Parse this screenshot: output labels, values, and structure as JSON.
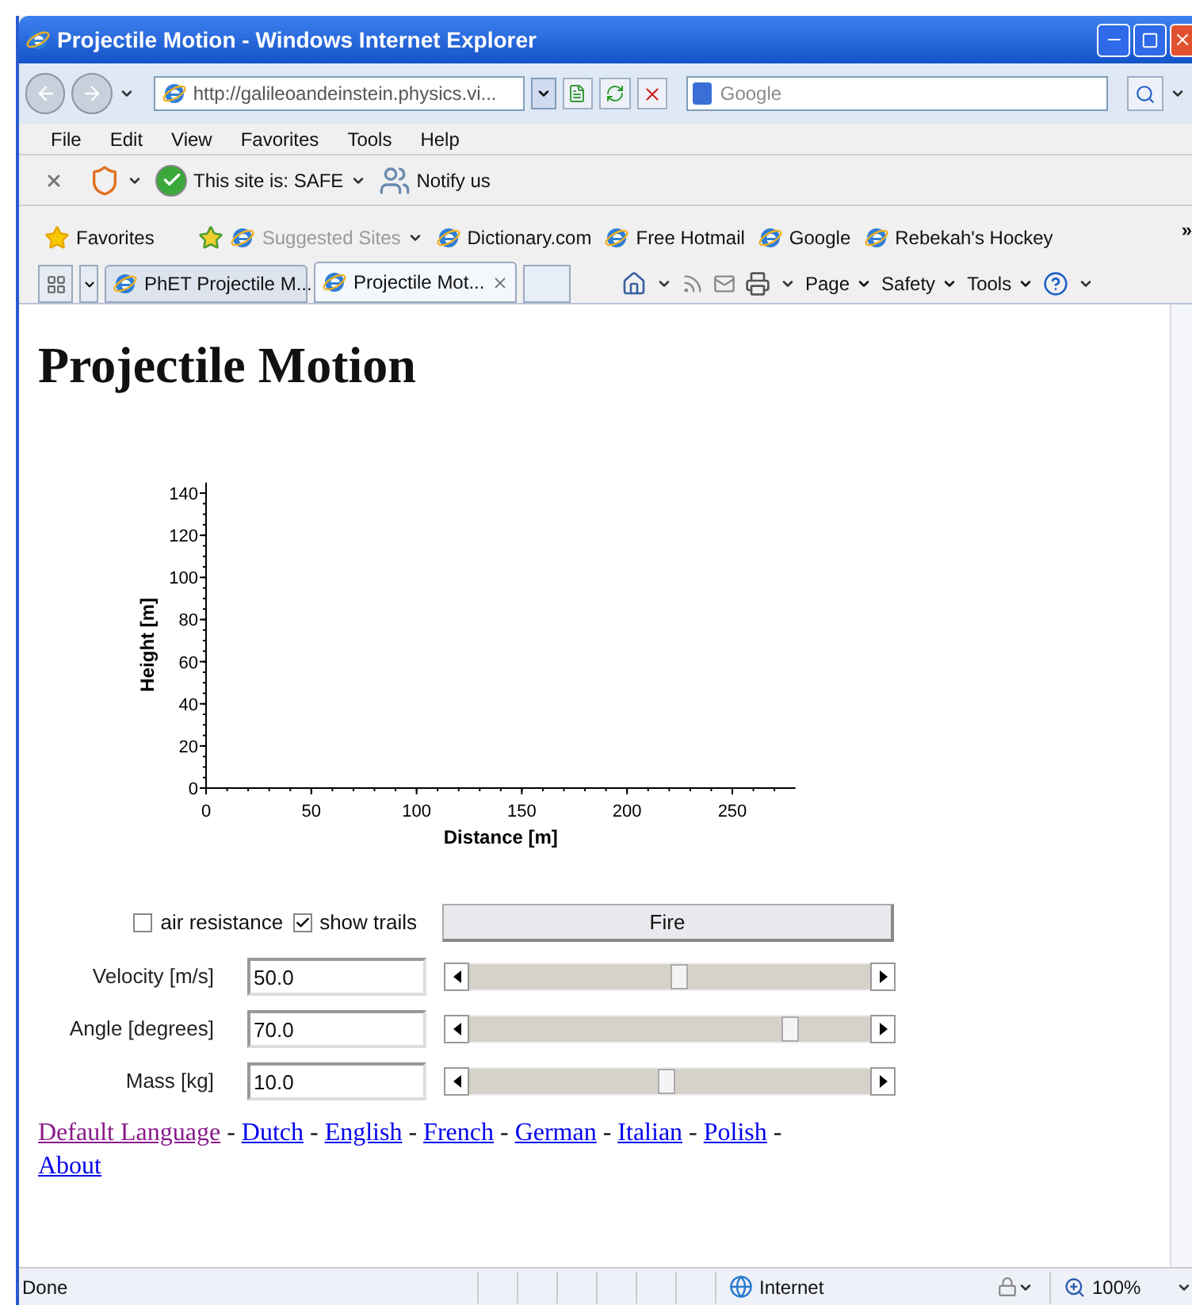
{
  "window": {
    "title": "Projectile Motion - Windows Internet Explorer"
  },
  "address": {
    "url": "http://galileoandeinstein.physics.vi..."
  },
  "search": {
    "placeholder": "Google"
  },
  "menu": [
    "File",
    "Edit",
    "View",
    "Favorites",
    "Tools",
    "Help"
  ],
  "toolbar": {
    "site_status": "This site is: SAFE",
    "notify": "Notify us"
  },
  "favorites": {
    "label": "Favorites",
    "items": [
      {
        "label": "Suggested Sites",
        "disabled": true
      },
      {
        "label": "Dictionary.com",
        "disabled": false
      },
      {
        "label": "Free Hotmail",
        "disabled": false
      },
      {
        "label": "Google",
        "disabled": false
      },
      {
        "label": "Rebekah's Hockey",
        "disabled": false
      }
    ],
    "more": "»"
  },
  "tabs": [
    {
      "label": "PhET Projectile M...",
      "selected": false
    },
    {
      "label": "Projectile Mot...",
      "selected": true
    }
  ],
  "command_bar": [
    "Page",
    "Safety",
    "Tools"
  ],
  "page": {
    "heading": "Projectile Motion",
    "chart_data": {
      "type": "line",
      "xlabel": "Distance [m]",
      "ylabel": "Height [m]",
      "xlim": [
        0,
        280
      ],
      "ylim": [
        0,
        145
      ],
      "xticks": [
        0,
        50,
        100,
        150,
        200,
        250
      ],
      "yticks": [
        0,
        20,
        40,
        60,
        80,
        100,
        120,
        140
      ]
    },
    "options": [
      {
        "label": "air resistance",
        "checked": false
      },
      {
        "label": "show trails",
        "checked": true
      }
    ],
    "fire_button": "Fire",
    "params": [
      {
        "label": "Velocity [m/s]",
        "value": "50.0",
        "level": 0.52
      },
      {
        "label": "Angle [degrees]",
        "value": "70.0",
        "level": 0.8
      },
      {
        "label": "Mass [kg]",
        "value": "10.0",
        "level": 0.49
      }
    ],
    "links": {
      "separator": "-",
      "items": [
        {
          "label": "Default Language",
          "visited": true
        },
        {
          "label": "Dutch",
          "visited": false
        },
        {
          "label": "English",
          "visited": false
        },
        {
          "label": "French",
          "visited": false
        },
        {
          "label": "German",
          "visited": false
        },
        {
          "label": "Italian",
          "visited": false
        },
        {
          "label": "Polish",
          "visited": false
        },
        {
          "label": "About",
          "visited": false
        }
      ]
    }
  },
  "status_bar": {
    "text": "Done",
    "zone": "Internet",
    "zoom": "100%"
  }
}
